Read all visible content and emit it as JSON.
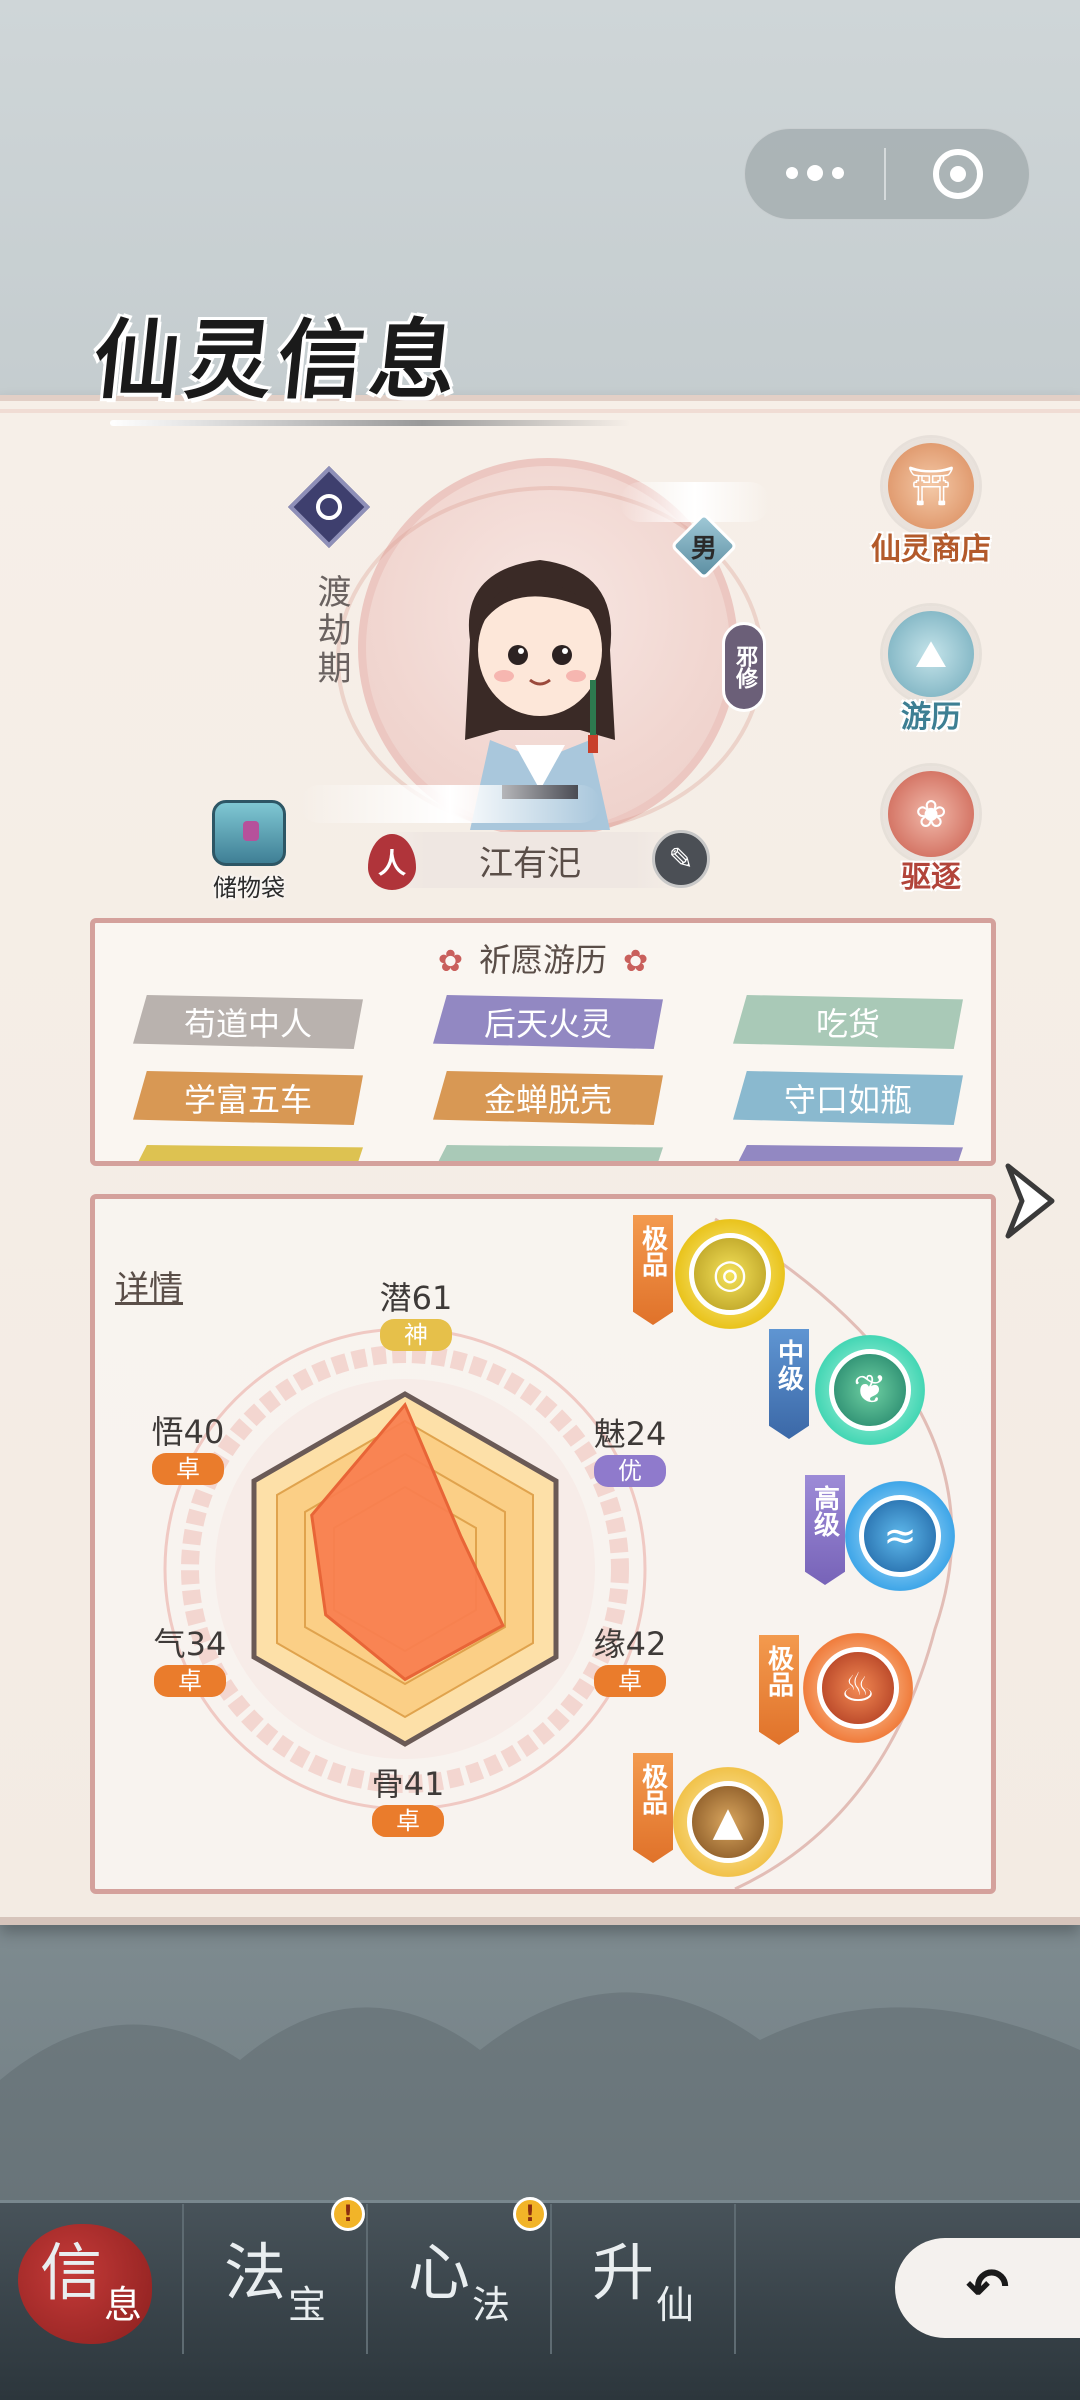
{
  "capsule": {
    "more_icon": "more-dots-icon",
    "close_icon": "target-circle-icon"
  },
  "title": "仙灵信息",
  "profile": {
    "realm": "渡劫期",
    "gender": "男",
    "path": "邪修",
    "race": "人",
    "name": "江有汜",
    "bag_label": "储物袋"
  },
  "side_buttons": [
    {
      "label": "仙灵商店",
      "icon": "shop-icon"
    },
    {
      "label": "游历",
      "icon": "mountain-icon"
    },
    {
      "label": "驱逐",
      "icon": "lotus-icon"
    }
  ],
  "wish": {
    "title": "祈愿游历",
    "tags": [
      {
        "label": "苟道中人",
        "color": "gray"
      },
      {
        "label": "后天火灵",
        "color": "purple"
      },
      {
        "label": "吃货",
        "color": "green"
      },
      {
        "label": "学富五车",
        "color": "orange"
      },
      {
        "label": "金蝉脱壳",
        "color": "orange"
      },
      {
        "label": "守口如瓶",
        "color": "blue"
      }
    ]
  },
  "stats": {
    "detail_label": "详情",
    "attributes": [
      {
        "label": "潜61",
        "grade": "神",
        "value": 61
      },
      {
        "label": "魅24",
        "grade": "优",
        "value": 24
      },
      {
        "label": "缘42",
        "grade": "卓",
        "value": 42
      },
      {
        "label": "骨41",
        "grade": "卓",
        "value": 41
      },
      {
        "label": "气34",
        "grade": "卓",
        "value": 34
      },
      {
        "label": "悟40",
        "grade": "卓",
        "value": 40
      }
    ],
    "elements": [
      {
        "grade": "极品",
        "element": "metal",
        "icon": "metal-swirl-icon"
      },
      {
        "grade": "中级",
        "element": "wood",
        "icon": "leaf-icon"
      },
      {
        "grade": "高级",
        "element": "water",
        "icon": "wave-icon"
      },
      {
        "grade": "极品",
        "element": "fire",
        "icon": "flame-icon"
      },
      {
        "grade": "极品",
        "element": "earth",
        "icon": "rock-icon"
      }
    ]
  },
  "tabs": [
    {
      "big": "信",
      "small": "息",
      "active": true,
      "alert": false
    },
    {
      "big": "法",
      "small": "宝",
      "active": false,
      "alert": true
    },
    {
      "big": "心",
      "small": "法",
      "active": false,
      "alert": true
    },
    {
      "big": "升",
      "small": "仙",
      "active": false,
      "alert": false
    }
  ],
  "alert_mark": "!",
  "back_icon": "back-arrow-icon"
}
